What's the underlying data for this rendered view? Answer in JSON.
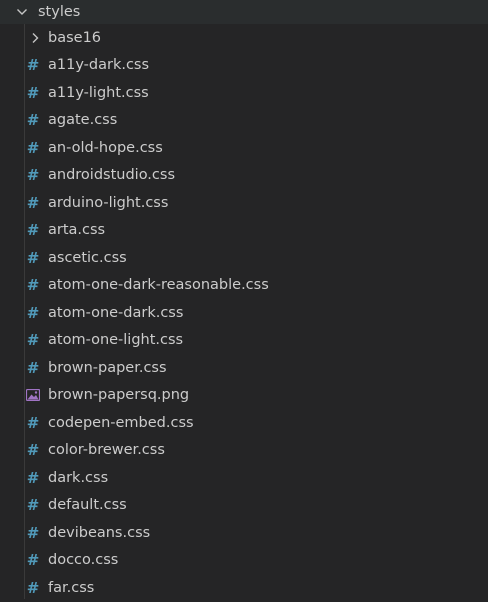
{
  "explorer": {
    "root_folder": {
      "label": "styles",
      "icon": "chevron-down-icon"
    },
    "items": [
      {
        "label": "base16",
        "type": "folder",
        "icon": "chevron-right-icon"
      },
      {
        "label": "a11y-dark.css",
        "type": "css",
        "icon": "hash-icon"
      },
      {
        "label": "a11y-light.css",
        "type": "css",
        "icon": "hash-icon"
      },
      {
        "label": "agate.css",
        "type": "css",
        "icon": "hash-icon"
      },
      {
        "label": "an-old-hope.css",
        "type": "css",
        "icon": "hash-icon"
      },
      {
        "label": "androidstudio.css",
        "type": "css",
        "icon": "hash-icon"
      },
      {
        "label": "arduino-light.css",
        "type": "css",
        "icon": "hash-icon"
      },
      {
        "label": "arta.css",
        "type": "css",
        "icon": "hash-icon"
      },
      {
        "label": "ascetic.css",
        "type": "css",
        "icon": "hash-icon"
      },
      {
        "label": "atom-one-dark-reasonable.css",
        "type": "css",
        "icon": "hash-icon"
      },
      {
        "label": "atom-one-dark.css",
        "type": "css",
        "icon": "hash-icon"
      },
      {
        "label": "atom-one-light.css",
        "type": "css",
        "icon": "hash-icon"
      },
      {
        "label": "brown-paper.css",
        "type": "css",
        "icon": "hash-icon"
      },
      {
        "label": "brown-papersq.png",
        "type": "image",
        "icon": "image-icon"
      },
      {
        "label": "codepen-embed.css",
        "type": "css",
        "icon": "hash-icon"
      },
      {
        "label": "color-brewer.css",
        "type": "css",
        "icon": "hash-icon"
      },
      {
        "label": "dark.css",
        "type": "css",
        "icon": "hash-icon"
      },
      {
        "label": "default.css",
        "type": "css",
        "icon": "hash-icon"
      },
      {
        "label": "devibeans.css",
        "type": "css",
        "icon": "hash-icon"
      },
      {
        "label": "docco.css",
        "type": "css",
        "icon": "hash-icon"
      },
      {
        "label": "far.css",
        "type": "css",
        "icon": "hash-icon"
      }
    ]
  },
  "colors": {
    "background": "#252526",
    "text": "#cccccc",
    "css_icon": "#519aba",
    "image_icon": "#a074c4",
    "folder_chevron": "#c5c5c5"
  }
}
